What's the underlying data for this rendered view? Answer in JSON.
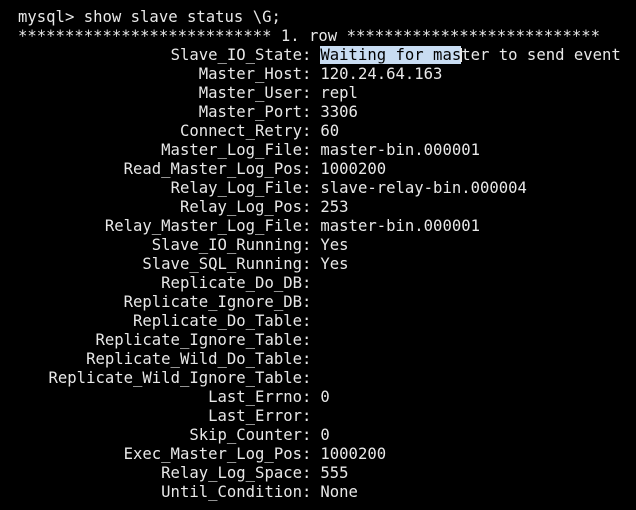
{
  "terminal": {
    "prompt": "mysql> show slave status \\G;",
    "row_separator": "*************************** 1. row ***************************"
  },
  "fields": [
    {
      "key": "Slave_IO_State",
      "value_hl": "Waiting for mas",
      "value_after_cursor": "ter to send event"
    },
    {
      "key": "Master_Host",
      "value": "120.24.64.163"
    },
    {
      "key": "Master_User",
      "value": "repl"
    },
    {
      "key": "Master_Port",
      "value": "3306"
    },
    {
      "key": "Connect_Retry",
      "value": "60"
    },
    {
      "key": "Master_Log_File",
      "value": "master-bin.000001"
    },
    {
      "key": "Read_Master_Log_Pos",
      "value": "1000200"
    },
    {
      "key": "Relay_Log_File",
      "value": "slave-relay-bin.000004"
    },
    {
      "key": "Relay_Log_Pos",
      "value": "253"
    },
    {
      "key": "Relay_Master_Log_File",
      "value": "master-bin.000001"
    },
    {
      "key": "Slave_IO_Running",
      "value": "Yes"
    },
    {
      "key": "Slave_SQL_Running",
      "value": "Yes"
    },
    {
      "key": "Replicate_Do_DB",
      "value": ""
    },
    {
      "key": "Replicate_Ignore_DB",
      "value": ""
    },
    {
      "key": "Replicate_Do_Table",
      "value": ""
    },
    {
      "key": "Replicate_Ignore_Table",
      "value": ""
    },
    {
      "key": "Replicate_Wild_Do_Table",
      "value": ""
    },
    {
      "key": "Replicate_Wild_Ignore_Table",
      "value": ""
    },
    {
      "key": "Last_Errno",
      "value": "0"
    },
    {
      "key": "Last_Error",
      "value": ""
    },
    {
      "key": "Skip_Counter",
      "value": "0"
    },
    {
      "key": "Exec_Master_Log_Pos",
      "value": "1000200"
    },
    {
      "key": "Relay_Log_Space",
      "value": "555"
    },
    {
      "key": "Until_Condition",
      "value": "None"
    }
  ],
  "colors": {
    "background": "#000000",
    "text": "#e8e8e8",
    "selection": "#c8dcf2"
  }
}
